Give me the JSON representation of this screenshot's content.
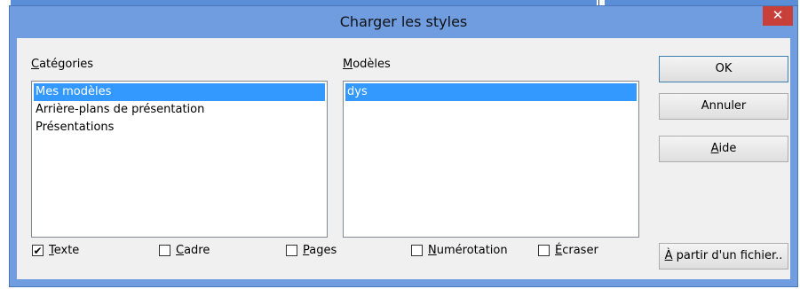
{
  "dialog": {
    "title": "Charger les styles",
    "close_glyph": "✕"
  },
  "categories": {
    "label_mnemonic": "C",
    "label_rest": "atégories",
    "items": [
      "Mes modèles",
      "Arrière-plans de présentation",
      "Présentations"
    ],
    "selected_index": 0
  },
  "models": {
    "label_mnemonic": "M",
    "label_rest": "odèles",
    "items": [
      "dys"
    ],
    "selected_index": 0
  },
  "buttons": {
    "ok": "OK",
    "cancel": "Annuler",
    "help_mnemonic": "A",
    "help_rest": "ide",
    "from_file_mnemonic": "À",
    "from_file_rest": " partir d'un fichier.."
  },
  "options": [
    {
      "mnemonic": "T",
      "rest": "exte",
      "checked": true
    },
    {
      "mnemonic": "C",
      "rest": "adre",
      "checked": false
    },
    {
      "mnemonic": "P",
      "rest": "ages",
      "checked": false
    },
    {
      "mnemonic": "N",
      "rest": "umérotation",
      "checked": false
    },
    {
      "mnemonic": "É",
      "rest": "craser",
      "checked": false
    }
  ],
  "check_glyph": "✔"
}
